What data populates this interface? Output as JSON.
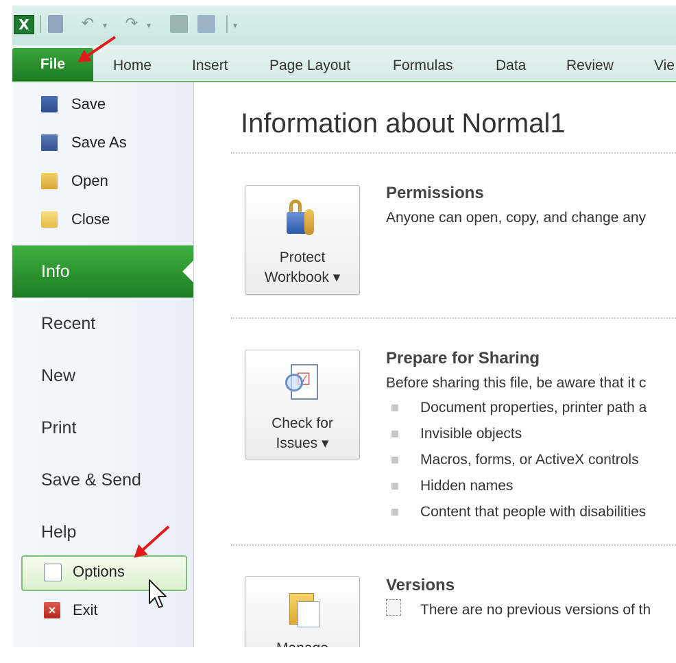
{
  "ribbon": {
    "tabs": [
      "File",
      "Home",
      "Insert",
      "Page Layout",
      "Formulas",
      "Data",
      "Review",
      "Vie"
    ]
  },
  "backstage": {
    "top_commands": [
      "Save",
      "Save As",
      "Open",
      "Close"
    ],
    "nav_tabs": [
      "Info",
      "Recent",
      "New",
      "Print",
      "Save & Send",
      "Help"
    ],
    "active_tab": "Info",
    "bottom_commands": [
      "Options",
      "Exit"
    ]
  },
  "info": {
    "title": "Information about Normal1",
    "permissions": {
      "button": [
        "Protect",
        "Workbook ▾"
      ],
      "heading": "Permissions",
      "text": "Anyone can open, copy, and change any"
    },
    "sharing": {
      "button": [
        "Check for",
        "Issues ▾"
      ],
      "heading": "Prepare for Sharing",
      "text": "Before sharing this file, be aware that it c",
      "items": [
        "Document properties, printer path a",
        "Invisible objects",
        "Macros, forms, or ActiveX controls",
        "Hidden names",
        "Content that people with disabilities"
      ]
    },
    "versions": {
      "button": [
        "Manage"
      ],
      "heading": "Versions",
      "text": "There are no previous versions of th"
    }
  },
  "colors": {
    "accent_green": "#1c7c23",
    "annotation_red": "#e01b1b"
  },
  "icons": {
    "app": "excel-logo-icon",
    "protect": "lock-key-icon",
    "check": "checklist-magnifier-icon",
    "versions": "document-versions-icon"
  }
}
